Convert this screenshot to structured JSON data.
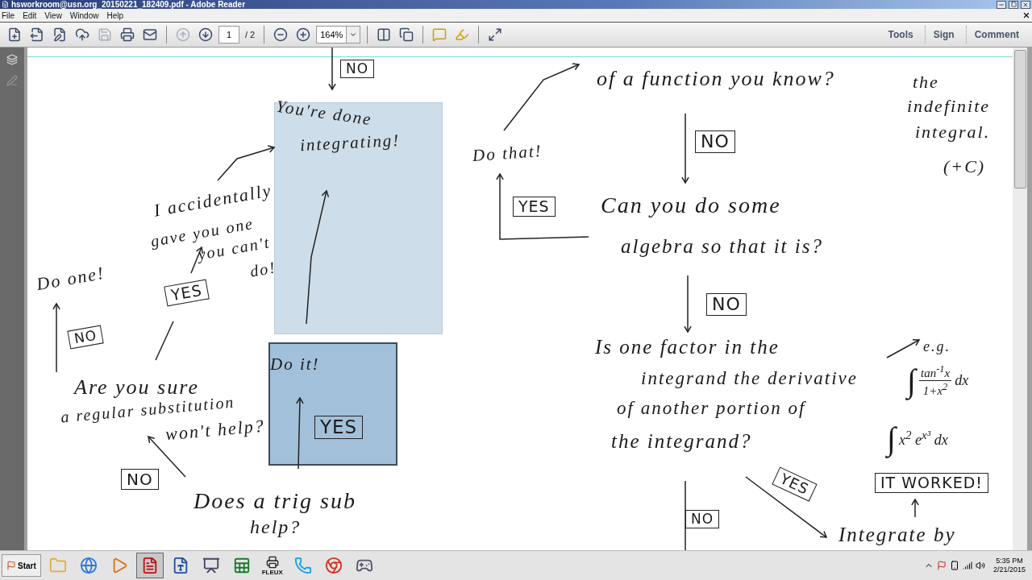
{
  "window": {
    "title": "hsworkroom@usn.org_20150221_182409.pdf - Adobe Reader"
  },
  "menu": [
    "File",
    "Edit",
    "View",
    "Window",
    "Help"
  ],
  "toolbar": {
    "buttons": [
      {
        "disabled": false
      },
      {
        "disabled": false
      },
      {
        "disabled": false
      },
      {
        "disabled": false
      },
      {
        "disabled": true
      },
      {
        "disabled": false
      },
      {
        "disabled": false
      },
      {
        "disabled": true
      },
      {
        "disabled": false
      }
    ],
    "page": {
      "value": "1",
      "total": "/ 2"
    },
    "zoom": {
      "value": "164%"
    },
    "panes": [
      "Tools",
      "Sign",
      "Comment"
    ]
  },
  "document": {
    "highlights": [
      {
        "color": "#cddeea"
      },
      {
        "color": "#a3c0da"
      }
    ],
    "notes": [
      {
        "kind": "boxed",
        "text": "NO"
      },
      {
        "kind": "text",
        "text": "of a function you know?"
      },
      {
        "kind": "text",
        "text": "the"
      },
      {
        "kind": "text",
        "text": "indefinite"
      },
      {
        "kind": "text",
        "text": "integral."
      },
      {
        "kind": "text",
        "text": "(+C)"
      },
      {
        "kind": "text",
        "text": "You're done"
      },
      {
        "kind": "text",
        "text": "integrating!"
      },
      {
        "kind": "text",
        "text": "Do that!"
      },
      {
        "kind": "boxed",
        "text": "NO"
      },
      {
        "kind": "boxed",
        "text": "YES"
      },
      {
        "kind": "text",
        "text": "Can you do some"
      },
      {
        "kind": "text",
        "text": "algebra so that it is?"
      },
      {
        "kind": "boxed",
        "text": "NO"
      },
      {
        "kind": "text",
        "text": "Is one factor in the"
      },
      {
        "kind": "text",
        "text": "integrand the derivative"
      },
      {
        "kind": "text",
        "text": "of another portion of"
      },
      {
        "kind": "text",
        "text": "the integrand?"
      },
      {
        "kind": "text",
        "text": "e.g."
      },
      {
        "kind": "fraction",
        "sign": "∫",
        "numerator": "tan$^{-1}$x",
        "denominator": "1+x$^{2}$",
        "tail": "dx"
      },
      {
        "kind": "formula",
        "sign": "∫",
        "text": "x$^{2}$ e$^{x³}$ dx"
      },
      {
        "kind": "boxed",
        "text": "YES"
      },
      {
        "kind": "boxed",
        "text": "IT WORKED!"
      },
      {
        "kind": "boxed",
        "text": "NO"
      },
      {
        "kind": "text",
        "text": "Integrate by"
      },
      {
        "kind": "text",
        "text": "I accidentally"
      },
      {
        "kind": "text",
        "text": "gave you one"
      },
      {
        "kind": "text",
        "text": "you can't"
      },
      {
        "kind": "text",
        "text": "do!"
      },
      {
        "kind": "text",
        "text": "Do one!"
      },
      {
        "kind": "boxed",
        "text": "YES"
      },
      {
        "kind": "boxed",
        "text": "NO"
      },
      {
        "kind": "text",
        "text": "Do it!"
      },
      {
        "kind": "boxed",
        "text": "YES"
      },
      {
        "kind": "text",
        "text": "Are you sure"
      },
      {
        "kind": "text",
        "text": "a regular substitution"
      },
      {
        "kind": "text",
        "text": "won't help?"
      },
      {
        "kind": "boxed",
        "text": "NO"
      },
      {
        "kind": "text",
        "text": "Does a trig sub"
      },
      {
        "kind": "text",
        "text": "help?"
      }
    ]
  },
  "taskbar": {
    "start": "Start",
    "apps": [
      {
        "selected": false
      },
      {
        "selected": false
      },
      {
        "selected": false
      },
      {
        "selected": true
      },
      {
        "selected": false
      },
      {
        "selected": false
      },
      {
        "selected": false
      },
      {
        "selected": false,
        "label": "FLEUX"
      },
      {
        "selected": false
      },
      {
        "selected": false
      },
      {
        "selected": false
      }
    ],
    "clock": {
      "time": "5:35 PM",
      "date": "2/21/2015"
    }
  }
}
